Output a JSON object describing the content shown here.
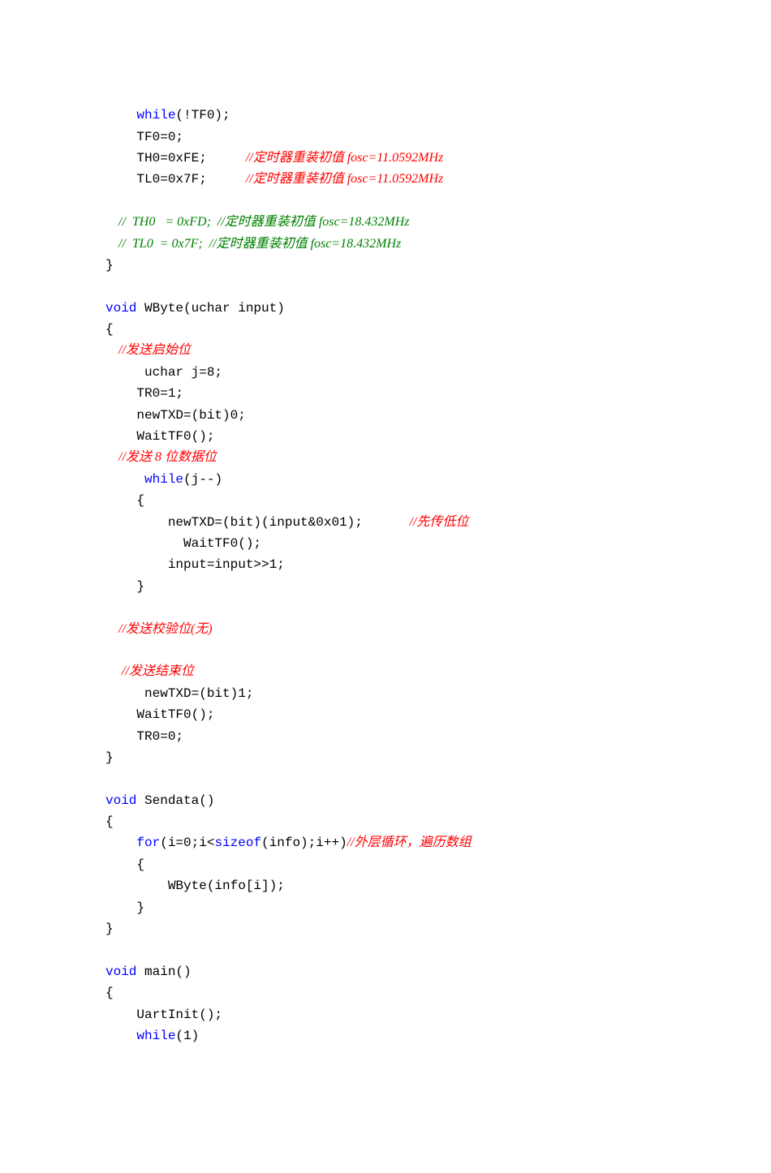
{
  "code": {
    "l1": "    while(!TF0);",
    "l2a": "    TF0=0;",
    "l3a": "    TH0=0xFE;     ",
    "l3c": "//",
    "l3d": "定时器重装初值",
    "l3e": " fosc=11.0592MHz",
    "l4a": "    TL0=0x7F;     ",
    "l4c": "//",
    "l4d": "定时器重装初值",
    "l4e": " fosc=11.0592MHz",
    "l5a": "    //  TH0   = 0xFD;  //",
    "l5b": "定时器重装初值",
    "l5c": " fosc=18.432MHz",
    "l6a": "    //  TL0  = 0x7F;  //",
    "l6b": "定时器重装初值",
    "l6c": " fosc=18.432MHz",
    "l7": "}",
    "l8": "void WByte(uchar input)",
    "l9": "{",
    "l10a": "    //",
    "l10b": "发送启始位",
    "l11": "     uchar j=8;",
    "l12": "    TR0=1;",
    "l13": "    newTXD=(bit)0;",
    "l14": "    WaitTF0();",
    "l15a": "    //",
    "l15b": "发送",
    "l15c": " 8 ",
    "l15d": "位数据位",
    "l16": "     while(j--)",
    "l17": "    {",
    "l18a": "        newTXD=(bit)(input&0x01);      ",
    "l18b": "//",
    "l18c": "先传低位",
    "l19": "          WaitTF0();",
    "l20": "        input=input>>1;",
    "l21": "    }",
    "l22a": "    //",
    "l22b": "发送校验位",
    "l22c": "(",
    "l22d": "无",
    "l22e": ")",
    "l23a": "     //",
    "l23b": "发送结束位",
    "l24": "     newTXD=(bit)1;",
    "l25": "    WaitTF0();",
    "l26": "    TR0=0;",
    "l27": "}",
    "l28": "void Sendata()",
    "l29": "{",
    "l30a": "    for(i=0;i<sizeof(info);i++)",
    "l30b": "//",
    "l30c": "外层循环，遍历数组",
    "l31": "    {",
    "l32": "        WByte(info[i]);",
    "l33": "    }",
    "l34": "}",
    "l35": "void main()",
    "l36": "{",
    "l37": "    UartInit();",
    "l38": "    while(1)"
  }
}
